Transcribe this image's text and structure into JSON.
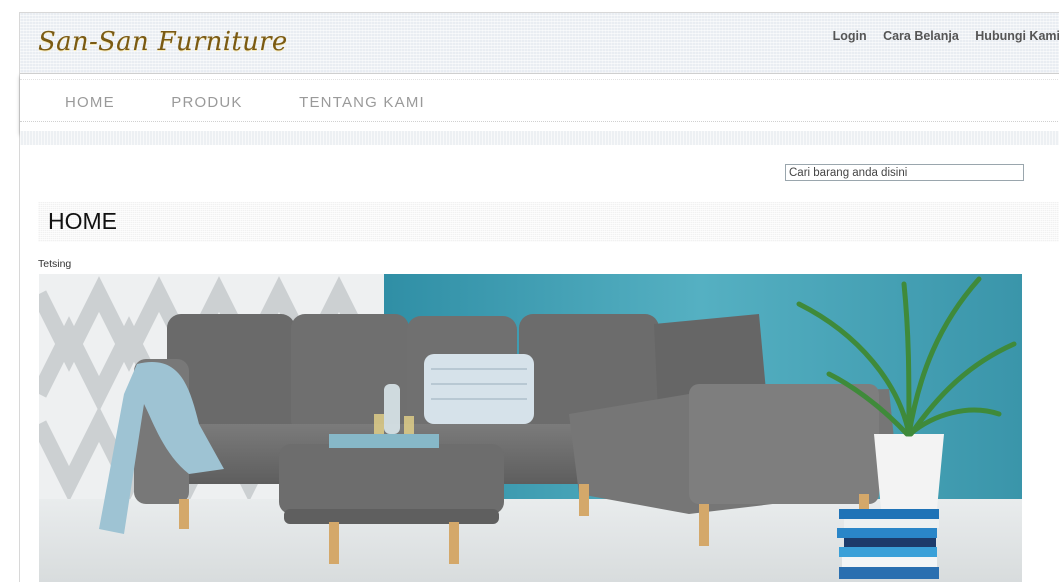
{
  "site": {
    "logo_text": "San-San Furniture"
  },
  "top_links": {
    "login": "Login",
    "cara_belanja": "Cara Belanja",
    "hubungi_kami": "Hubungi Kami"
  },
  "nav": {
    "items": [
      {
        "label": "HOME"
      },
      {
        "label": "PRODUK"
      },
      {
        "label": "TENTANG KAMI"
      }
    ]
  },
  "search": {
    "value": "Cari barang anda disini"
  },
  "main": {
    "title": "HOME",
    "caption": "Tetsing"
  },
  "hero_image": {
    "subject": "gray sectional sofa with ottoman, blanket, pillow and potted plant"
  },
  "colors": {
    "logo": "#7a5a14",
    "wall_blue": "#3f9bb0",
    "sofa_gray": "#707070"
  }
}
